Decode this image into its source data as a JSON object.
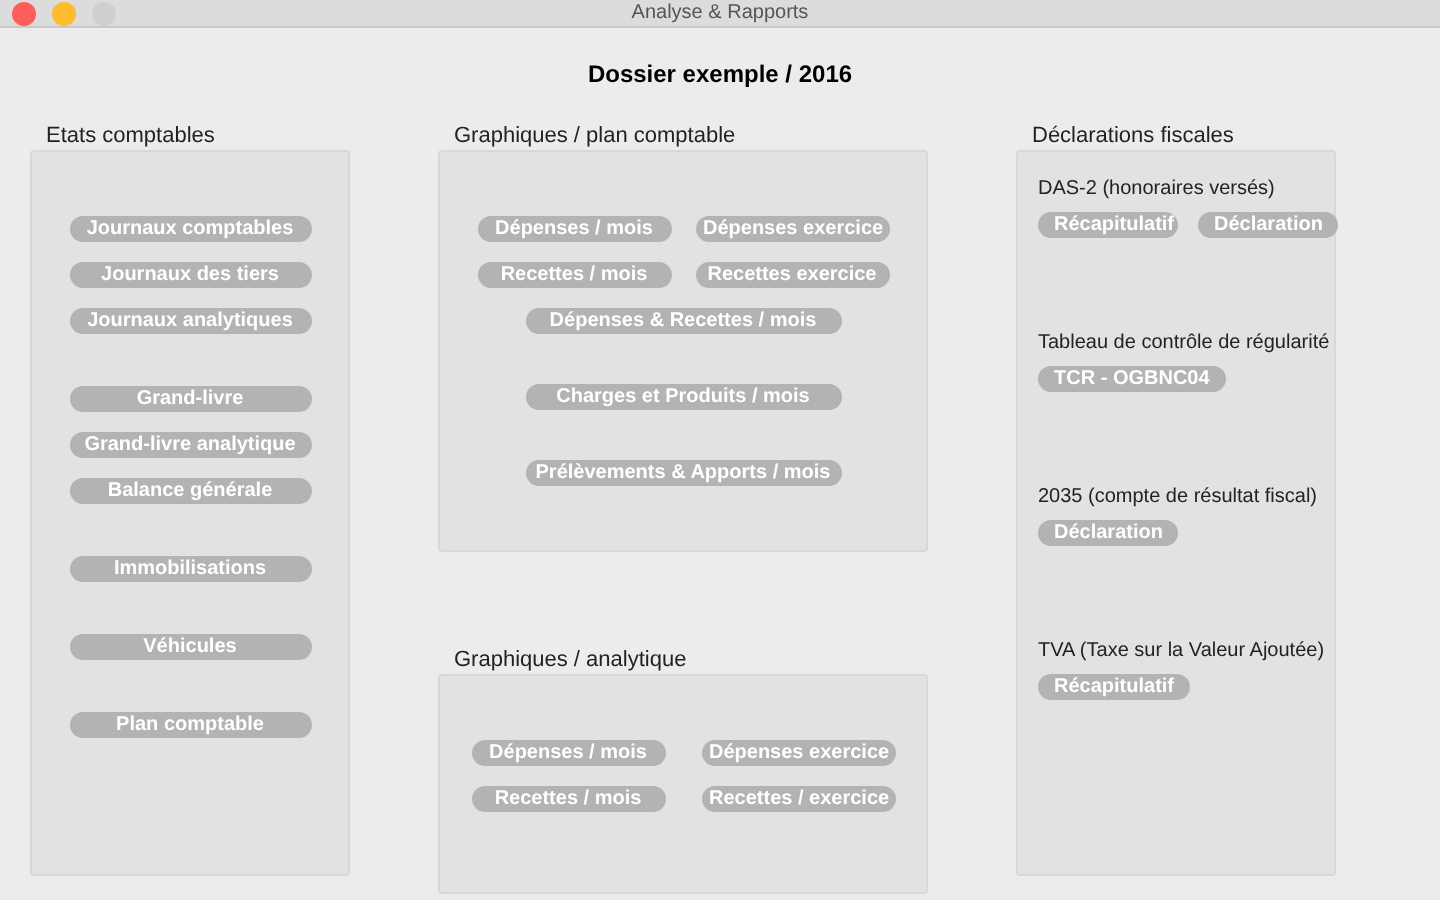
{
  "window": {
    "title": "Analyse & Rapports"
  },
  "heading": "Dossier exemple / 2016",
  "etats": {
    "title": "Etats comptables",
    "groups": [
      [
        [
          "Journaux comptables"
        ],
        [
          "Journaux des tiers"
        ],
        [
          "Journaux analytiques"
        ]
      ],
      [
        [
          "Grand-livre"
        ],
        [
          "Grand-livre analytique"
        ],
        [
          "Balance générale"
        ]
      ],
      [
        [
          "Immobilisations"
        ]
      ],
      [
        [
          "Véhicules"
        ]
      ],
      [
        [
          "Plan comptable"
        ]
      ]
    ]
  },
  "graph_plan": {
    "title": "Graphiques / plan comptable",
    "groups": [
      [
        [
          "Dépenses / mois",
          "Dépenses exercice"
        ],
        [
          "Recettes / mois",
          "Recettes exercice"
        ],
        [
          "Dépenses & Recettes / mois"
        ]
      ],
      [
        [
          "Charges et Produits / mois"
        ]
      ],
      [
        [
          "Prélèvements & Apports / mois"
        ]
      ]
    ]
  },
  "graph_analytique": {
    "title": "Graphiques / analytique",
    "groups": [
      [
        [
          "Dépenses / mois",
          "Dépenses exercice"
        ],
        [
          "Recettes / mois",
          "Recettes / exercice"
        ]
      ]
    ]
  },
  "declarations": {
    "title": "Déclarations fiscales",
    "sections": [
      {
        "title": "DAS-2 (honoraires versés)",
        "buttons": [
          "Récapitulatif",
          "Déclaration"
        ]
      },
      {
        "title": "Tableau de contrôle de régularité",
        "buttons": [
          "TCR - OGBNC04"
        ]
      },
      {
        "title": "2035 (compte de résultat fiscal)",
        "buttons": [
          "Déclaration"
        ]
      },
      {
        "title": "TVA (Taxe sur la Valeur Ajoutée)",
        "buttons": [
          "Récapitulatif"
        ]
      }
    ]
  }
}
